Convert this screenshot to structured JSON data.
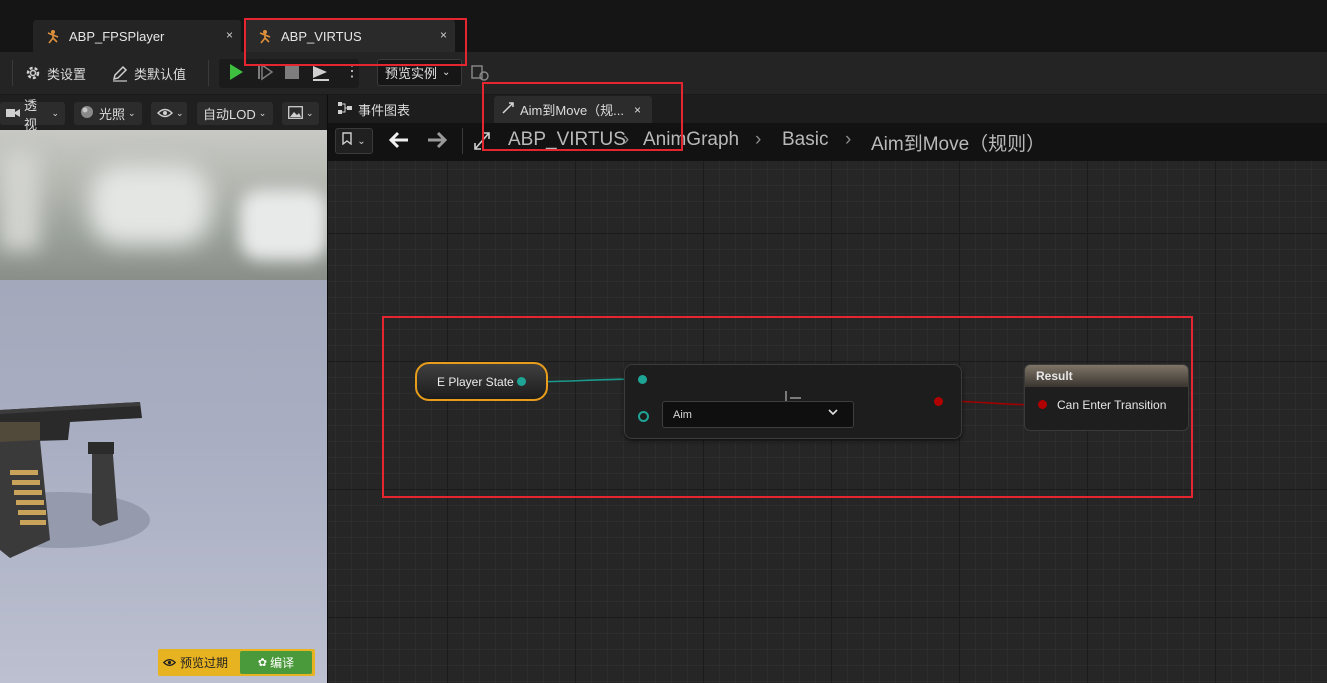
{
  "document_tabs": [
    {
      "label": "ABP_FPSPlayer",
      "close": "×"
    },
    {
      "label": "ABP_VIRTUS",
      "close": "×"
    }
  ],
  "toolbar": {
    "class_settings": "类设置",
    "class_defaults": "类默认值",
    "preview_instance": "预览实例"
  },
  "viewport": {
    "perspective": "透视",
    "lighting": "光照",
    "lod": "自动LOD",
    "preview_outdated": "预览过期",
    "compile": "编译"
  },
  "graph_tabs": {
    "event_graph": "事件图表",
    "active_tab": "Aim到Move（规...",
    "close": "×"
  },
  "breadcrumb": [
    "ABP_VIRTUS",
    "AnimGraph",
    "Basic",
    "Aim到Move（规则）"
  ],
  "nodes": {
    "variable": "E Player State",
    "enum_value": "Aim",
    "result_title": "Result",
    "result_pin": "Can Enter Transition"
  },
  "colors": {
    "highlight_box": "#e3262f",
    "variable_outline": "#e79c1c",
    "enum_wire": "#1a9a8c",
    "bool_wire": "#a10000",
    "play_green": "#3fbf3f"
  }
}
